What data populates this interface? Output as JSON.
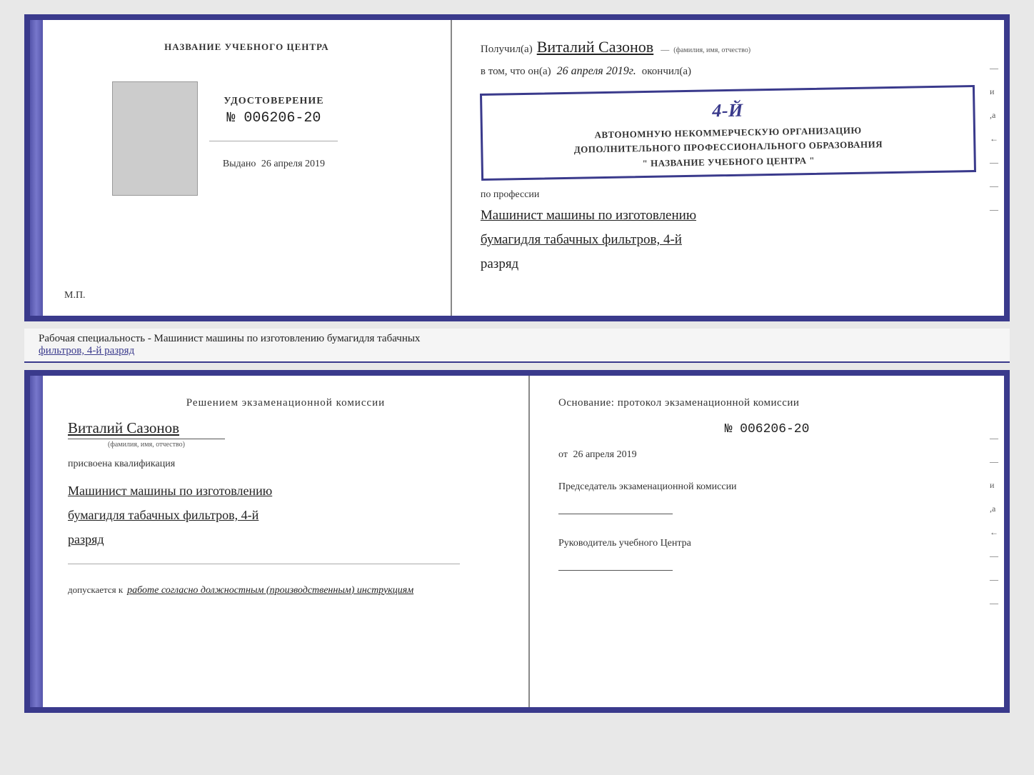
{
  "top_cert": {
    "left": {
      "center_title": "НАЗВАНИЕ УЧЕБНОГО ЦЕНТРА",
      "cert_label": "УДОСТОВЕРЕНИЕ",
      "cert_number": "№ 006206-20",
      "issued_label": "Выдано",
      "issued_date": "26 апреля 2019",
      "mp": "М.П."
    },
    "right": {
      "received_prefix": "Получил(а)",
      "person_name": "Виталий Сазонов",
      "fio_label": "(фамилия, имя, отчество)",
      "in_that_prefix": "в том, что он(а)",
      "date_handwritten": "26 апреля 2019г.",
      "finished_label": "окончил(а)",
      "big_number": "4-й",
      "org_line1": "АВТОНОМНУЮ НЕКОММЕРЧЕСКУЮ ОРГАНИЗАЦИЮ",
      "org_line2": "ДОПОЛНИТЕЛЬНОГО ПРОФЕССИОНАЛЬНОГО ОБРАЗОВАНИЯ",
      "org_name": "\" НАЗВАНИЕ УЧЕБНОГО ЦЕНТРА \"",
      "profession_prefix": "по профессии",
      "profession_hw": "Машинист машины по изготовлению бумагидля табачных фильтров, 4-й разряд"
    },
    "side_marks": [
      "-",
      "и",
      ",а",
      "←",
      "-",
      "-",
      "-",
      "-"
    ]
  },
  "info_bar": {
    "text_prefix": "Рабочая специальность - Машинист машины по изготовлению бумагидля табачных",
    "text_underline": "фильтров, 4-й разряд"
  },
  "bottom_cert": {
    "left": {
      "commission_title": "Решением  экзаменационной  комиссии",
      "person_name": "Виталий Сазонов",
      "fio_label": "(фамилия, имя, отчество)",
      "qualification_label": "присвоена квалификация",
      "qualification_hw": "Машинист машины по изготовлению бумагидля табачных фильтров, 4-й разряд",
      "allowed_prefix": "допускается к",
      "allowed_hw": "работе согласно должностным (производственным) инструкциям"
    },
    "right": {
      "basis_title": "Основание:  протокол  экзаменационной  комиссии",
      "protocol_number": "№  006206-20",
      "date_prefix": "от",
      "date_value": "26 апреля 2019",
      "chairman_label": "Председатель экзаменационной комиссии",
      "director_label": "Руководитель учебного Центра"
    },
    "side_marks": [
      "-",
      "-",
      "и",
      ",а",
      "←",
      "-",
      "-",
      "-",
      "-"
    ]
  }
}
